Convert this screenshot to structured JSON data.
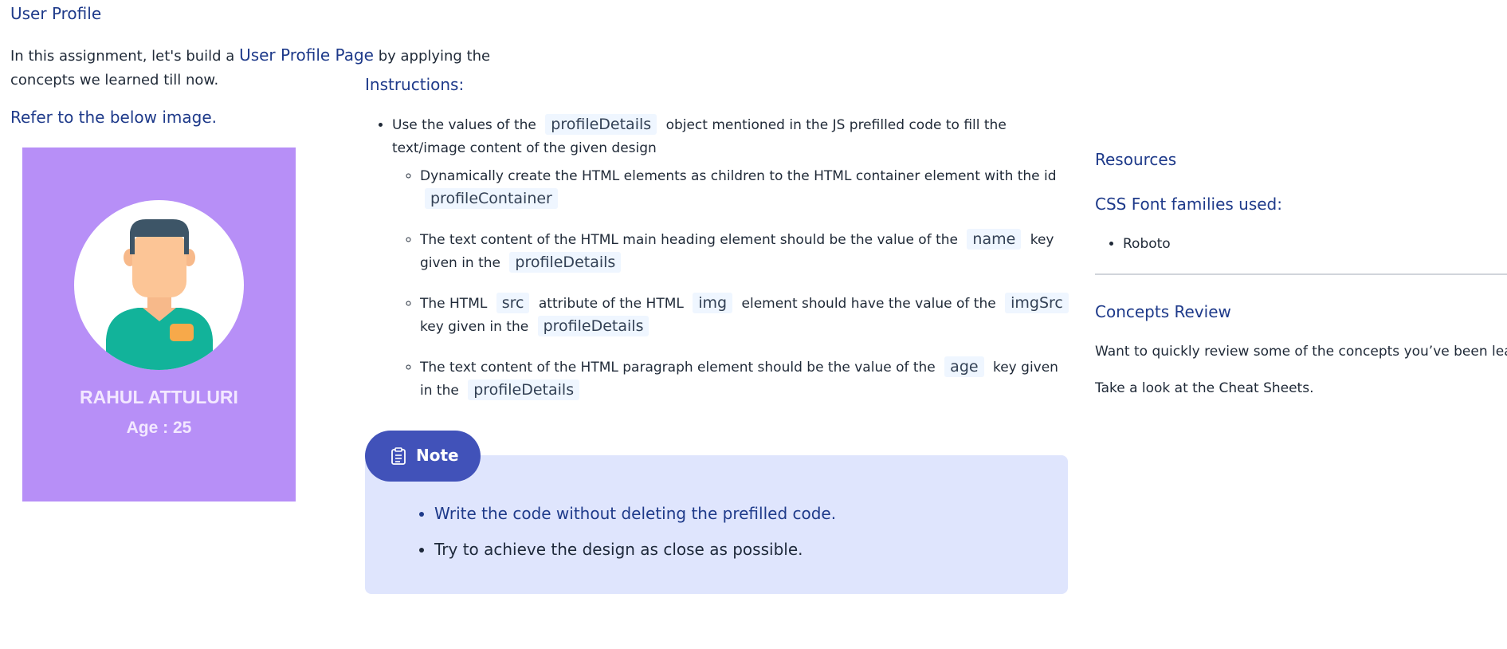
{
  "header": {
    "title": "User Profile",
    "intro_prefix": "In this assignment, let's build a ",
    "intro_highlight": "User Profile Page",
    "intro_suffix": " by applying the concepts we learned till now.",
    "refer": "Refer to the below image."
  },
  "profile_card": {
    "name": "RAHUL ATTULURI",
    "age": "Age : 25",
    "background": "#b78ff7"
  },
  "instructions": {
    "title": "Instructions:",
    "main": {
      "prefix": "Use the values of the",
      "code": "profileDetails",
      "suffix": "object mentioned in the JS prefilled code to fill the text/image content of the given design"
    },
    "sub": [
      {
        "t1": "Dynamically create the HTML elements as children to the HTML container element with the id",
        "c1": "profileContainer"
      },
      {
        "t1": "The text content of the HTML main heading element should be the value of the",
        "c1": "name",
        "t2": "key given in the",
        "c2": "profileDetails"
      },
      {
        "t1": "The HTML",
        "c1": "src",
        "t2": "attribute of the HTML",
        "c2": "img",
        "t3": "element should have the value of the",
        "c3": "imgSrc",
        "t4": "key given in the",
        "c4": "profileDetails"
      },
      {
        "t1": "The text content of the HTML paragraph element should be the value of the",
        "c1": "age",
        "t2": "key given in the",
        "c2": "profileDetails"
      }
    ]
  },
  "note": {
    "label": "Note",
    "items": [
      "Write the code without deleting the prefilled code.",
      "Try to achieve the design as close as possible."
    ]
  },
  "resources": {
    "title": "Resources",
    "fonts_title": "CSS Font families used:",
    "fonts": [
      "Roboto"
    ],
    "concepts_title": "Concepts Review",
    "concepts_text": "Want to quickly review some of the concepts you’ve been learn",
    "cheat_text": "Take a look at the Cheat Sheets."
  }
}
